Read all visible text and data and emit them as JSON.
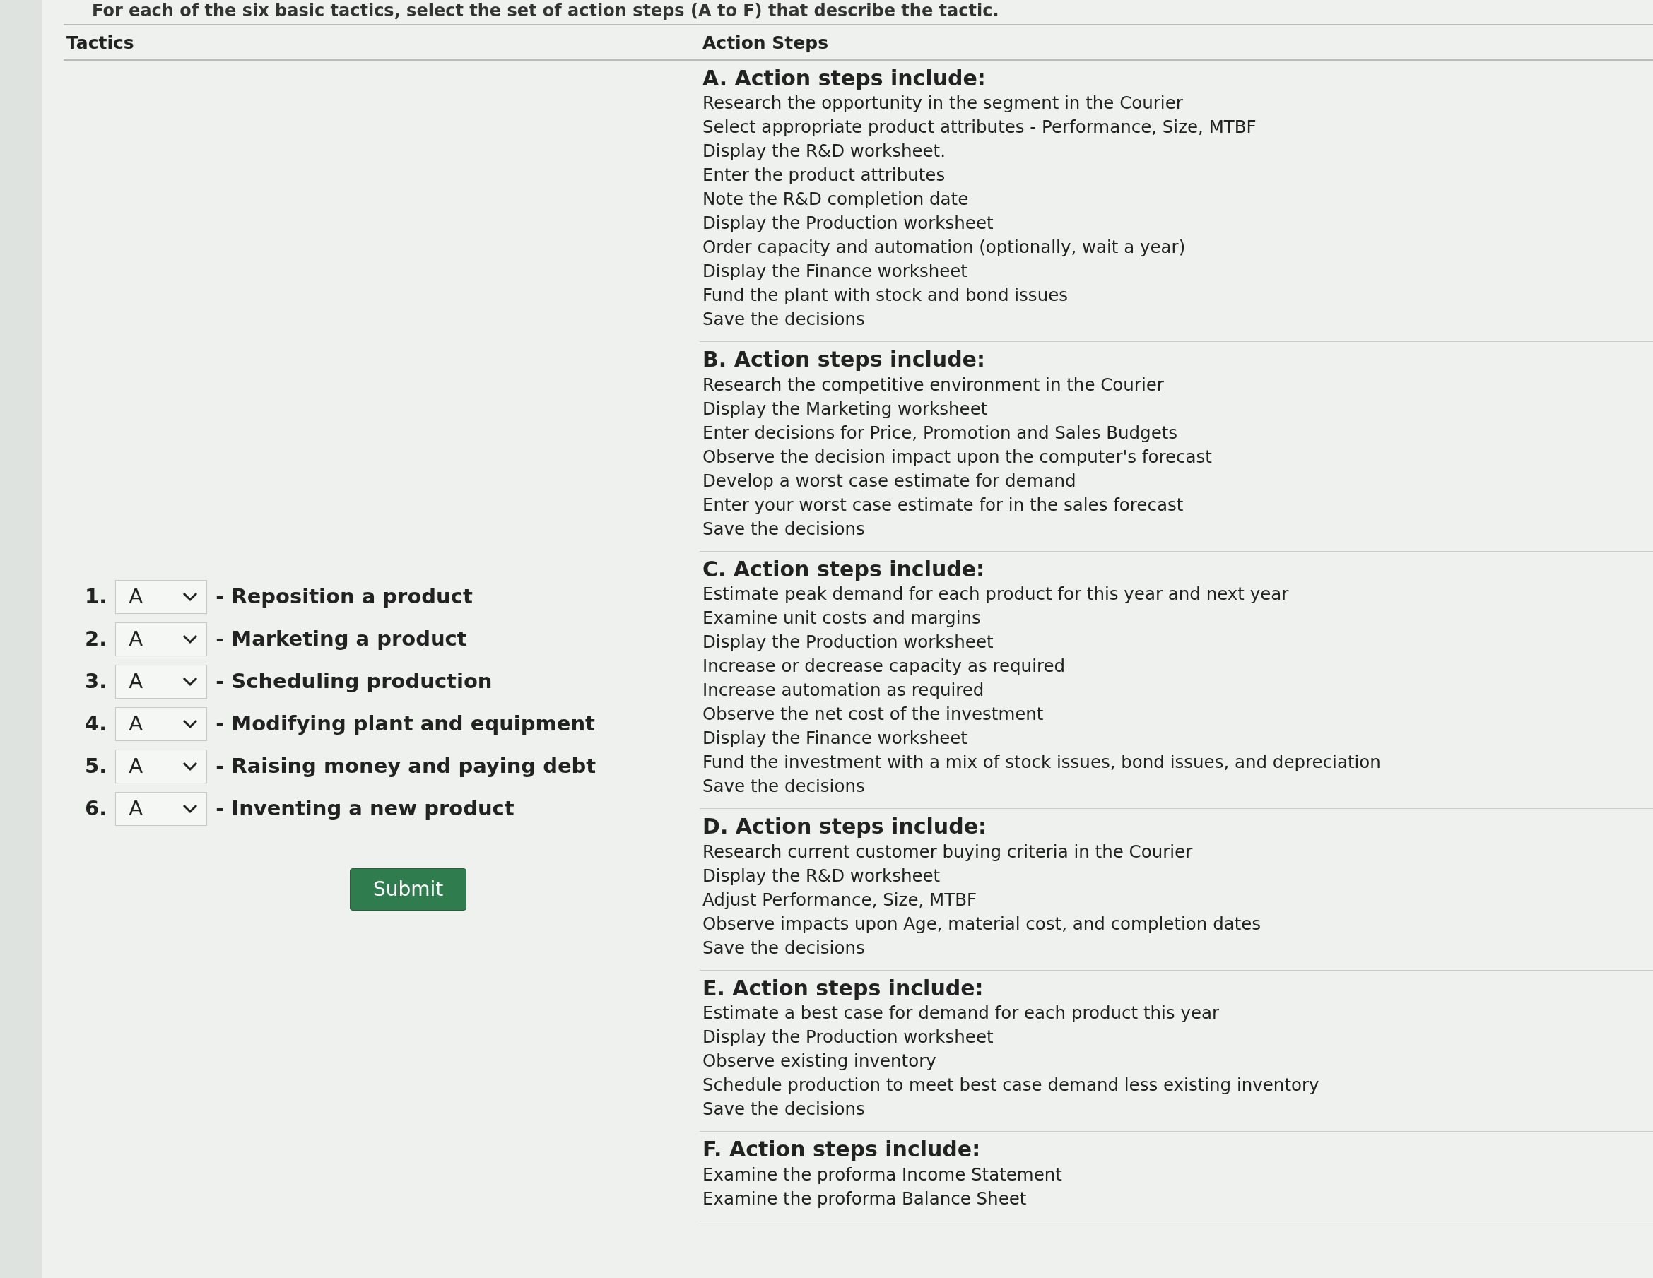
{
  "instruction": "For each of the six basic tactics, select the set of action steps (A to F) that describe the tactic.",
  "columns": {
    "tactics": "Tactics",
    "action_steps": "Action Steps"
  },
  "tactics": [
    {
      "number": "1.",
      "value": "A",
      "label": "- Reposition a product"
    },
    {
      "number": "2.",
      "value": "A",
      "label": "- Marketing a product"
    },
    {
      "number": "3.",
      "value": "A",
      "label": "- Scheduling production"
    },
    {
      "number": "4.",
      "value": "A",
      "label": "- Modifying plant and equipment"
    },
    {
      "number": "5.",
      "value": "A",
      "label": "- Raising money and paying debt"
    },
    {
      "number": "6.",
      "value": "A",
      "label": "- Inventing a new product"
    }
  ],
  "submit_button": "Submit",
  "action_sets": [
    {
      "heading": "A. Action steps include:",
      "steps": [
        "Research the opportunity in the segment in the Courier",
        "Select appropriate product attributes - Performance, Size, MTBF",
        "Display the R&D worksheet.",
        "Enter the product attributes",
        "Note the R&D completion date",
        "Display the Production worksheet",
        "Order capacity and automation (optionally, wait a year)",
        "Display the Finance worksheet",
        "Fund the plant with stock and bond issues",
        "Save the decisions"
      ]
    },
    {
      "heading": "B. Action steps include:",
      "steps": [
        "Research the competitive environment in the Courier",
        "Display the Marketing worksheet",
        "Enter decisions for Price, Promotion and Sales Budgets",
        "Observe the decision impact upon the computer's forecast",
        "Develop a worst case estimate for demand",
        "Enter your worst case estimate for in the sales forecast",
        "Save the decisions"
      ]
    },
    {
      "heading": "C. Action steps include:",
      "steps": [
        "Estimate peak demand for each product for this year and next year",
        "Examine unit costs and margins",
        "Display the Production worksheet",
        "Increase or decrease capacity as required",
        "Increase automation as required",
        "Observe the net cost of the investment",
        "Display the Finance worksheet",
        "Fund the investment with a mix of stock issues, bond issues, and depreciation",
        "Save the decisions"
      ]
    },
    {
      "heading": "D. Action steps include:",
      "steps": [
        "Research current customer buying criteria in the Courier",
        "Display the R&D worksheet",
        "Adjust Performance, Size, MTBF",
        "Observe impacts upon Age, material cost, and completion dates",
        "Save the decisions"
      ]
    },
    {
      "heading": "E. Action steps include:",
      "steps": [
        "Estimate a best case for demand for each product this year",
        "Display the Production worksheet",
        "Observe existing inventory",
        "Schedule production to meet best case demand less existing inventory",
        "Save the decisions"
      ]
    },
    {
      "heading": "F. Action steps include:",
      "steps": [
        "Examine the proforma Income Statement",
        "Examine the proforma Balance Sheet"
      ]
    }
  ]
}
